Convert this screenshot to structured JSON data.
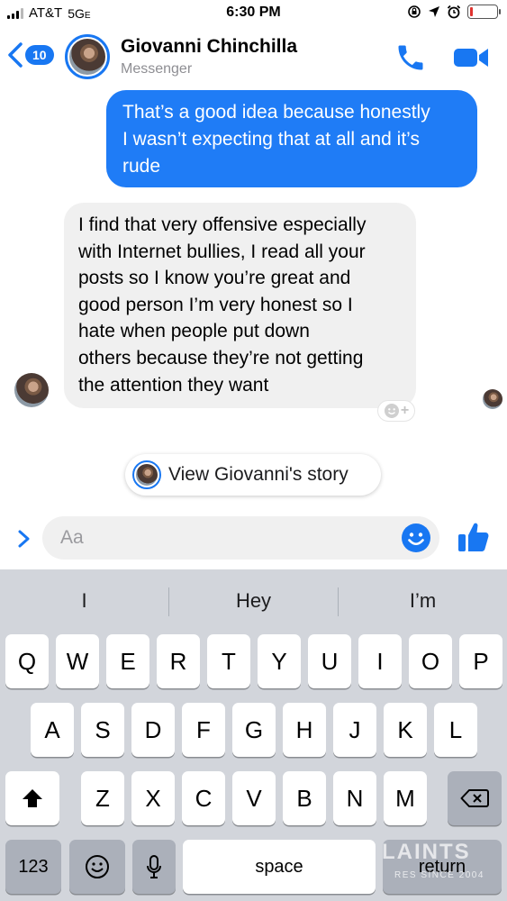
{
  "status_bar": {
    "carrier": "AT&T",
    "network": "5G",
    "network_suffix": "E",
    "time": "6:30 PM",
    "battery_level": 0.12,
    "icons": [
      "cellular-signal-icon",
      "screen-rotation-lock-icon",
      "location-arrow-icon",
      "alarm-icon",
      "battery-icon"
    ]
  },
  "header": {
    "unread_count": "10",
    "contact_name": "Giovanni Chinchilla",
    "subtitle": "Messenger",
    "icons": [
      "back-chevron-icon",
      "phone-icon",
      "video-camera-icon"
    ]
  },
  "messages": [
    {
      "direction": "outgoing",
      "lines": [
        "That’s a good idea because honestly",
        "I wasn’t expecting that at all and it’s",
        "rude"
      ]
    },
    {
      "direction": "incoming",
      "lines": [
        "I find that very offensive especially",
        "with Internet bullies, I read all your",
        "posts so I know you’re great and",
        "good person I’m very honest so I",
        "hate when people put down",
        "others because they’re not getting",
        "the attention they want"
      ]
    }
  ],
  "story_pill": {
    "label": "View Giovanni's story"
  },
  "composer": {
    "placeholder": "Aa",
    "value": "",
    "icons": [
      "expand-chevron-icon",
      "emoji-icon",
      "thumbs-up-icon"
    ]
  },
  "keyboard": {
    "predictions": [
      "I",
      "Hey",
      "I’m"
    ],
    "row1": [
      "Q",
      "W",
      "E",
      "R",
      "T",
      "Y",
      "U",
      "I",
      "O",
      "P"
    ],
    "row2": [
      "A",
      "S",
      "D",
      "F",
      "G",
      "H",
      "J",
      "K",
      "L"
    ],
    "row3": [
      "Z",
      "X",
      "C",
      "V",
      "B",
      "N",
      "M"
    ],
    "numbers_label": "123",
    "space_label": "space",
    "return_label": "return",
    "icons": [
      "shift-icon",
      "backspace-icon",
      "emoji-keyboard-icon",
      "microphone-icon"
    ]
  },
  "watermark": {
    "text": "LAINTS",
    "sub": "RES SINCE 2004"
  },
  "colors": {
    "accent": "#1877f2",
    "outgoing_bubble": "#1f7cf6",
    "incoming_bubble": "#f0f0f0",
    "keyboard_bg": "#d2d5db"
  }
}
